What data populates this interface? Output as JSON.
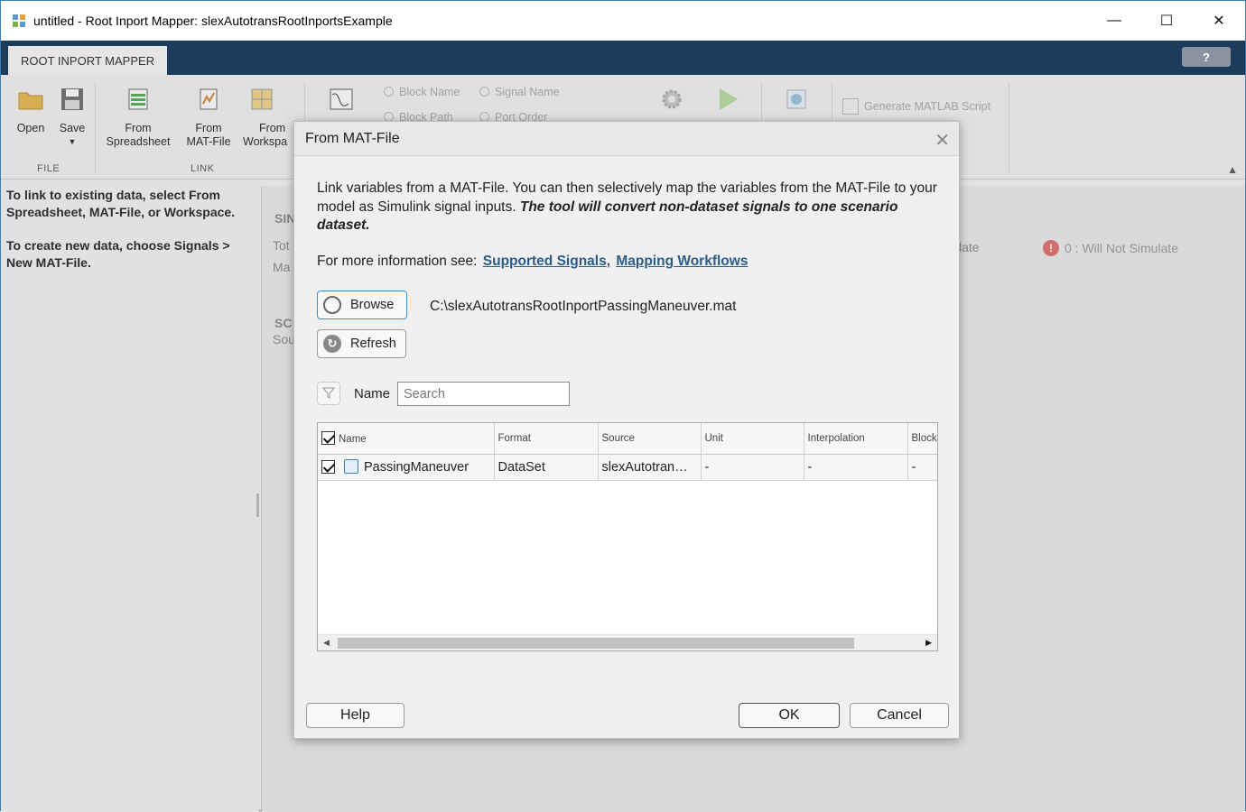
{
  "window": {
    "title": "untitled - Root Inport Mapper: slexAutotransRootInportsExample",
    "minimize": "—",
    "maximize": "☐",
    "close": "✕"
  },
  "ribbon": {
    "tab": "ROOT INPORT MAPPER",
    "help": "?",
    "open": "Open",
    "save": "Save",
    "from_spreadsheet_1": "From",
    "from_spreadsheet_2": "Spreadsheet",
    "from_matfile_1": "From",
    "from_matfile_2": "MAT-File",
    "from_workspace_1": "From",
    "from_workspace_2": "Workspa",
    "group_file": "FILE",
    "group_link": "LINK",
    "map_block_name": "Block Name",
    "map_signal_name": "Signal Name",
    "map_block_path": "Block Path",
    "map_port_order": "Port Order",
    "generate_script": "Generate MATLAB Script"
  },
  "left_panel": {
    "text1": "To link to existing data, select From Spreadsheet, MAT-File, or Workspace.",
    "text2": "To create new data, choose Signals > New MAT-File."
  },
  "background": {
    "sim_header": "SIN",
    "tot": "Tot",
    "ma": "Ma",
    "sc_header": "SC",
    "sou": "Sou",
    "late": "late",
    "will_not_simulate": "0 : Will Not Simulate",
    "err_icon": "!"
  },
  "dialog": {
    "title": "From MAT-File",
    "close": "✕",
    "desc_plain": "Link variables from a MAT-File. You can then selectively map the variables from the MAT-File to your model as Simulink signal inputs. ",
    "desc_italic": "The tool will convert non-dataset signals to one scenario dataset.",
    "info_prefix": "For more information see:",
    "link1": "Supported Signals",
    "link_sep": ",",
    "link2": "Mapping Workflows",
    "browse": "Browse",
    "refresh": "Refresh",
    "file_path": "C:\\slexAutotransRootInportPassingManeuver.mat",
    "filter_name_label": "Name",
    "search_placeholder": "Search",
    "table": {
      "headers": [
        "Name",
        "Format",
        "Source",
        "Unit",
        "Interpolation",
        "Block"
      ],
      "rows": [
        [
          "PassingManeuver",
          "DataSet",
          "slexAutotran…",
          "-",
          "-",
          "-"
        ]
      ]
    },
    "help": "Help",
    "ok": "OK",
    "cancel": "Cancel"
  }
}
